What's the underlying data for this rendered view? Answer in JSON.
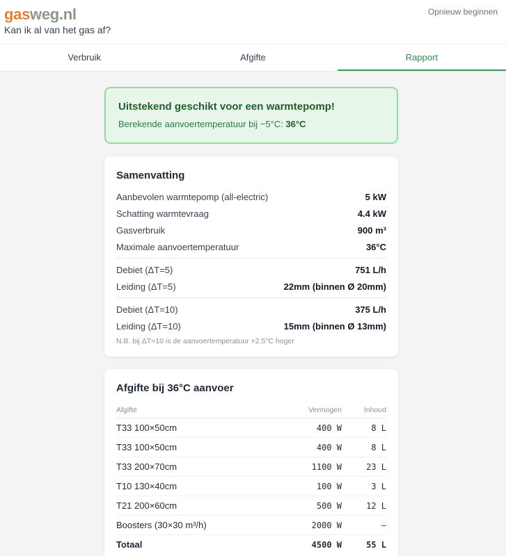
{
  "header": {
    "logo_part1": "gas",
    "logo_part2": "weg",
    "logo_part3": ".nl",
    "tagline": "Kan ik al van het gas af?",
    "restart_label": "Opnieuw beginnen"
  },
  "tabs": [
    {
      "label": "Verbruik",
      "active": false
    },
    {
      "label": "Afgifte",
      "active": false
    },
    {
      "label": "Rapport",
      "active": true
    }
  ],
  "banner": {
    "title": "Uitstekend geschikt voor een warmtepomp!",
    "sub_text": "Berekende aanvoertemperatuur bij −5°C:",
    "sub_value": "36°C"
  },
  "summary": {
    "title": "Samenvatting",
    "rows": [
      {
        "label": "Aanbevolen warmtepomp (all-electric)",
        "value": "5 kW"
      },
      {
        "label": "Schatting warmtevraag",
        "value": "4.4 kW"
      },
      {
        "label": "Gasverbruik",
        "value": "900 m³"
      },
      {
        "label": "Maximale aanvoertemperatuur",
        "value": "36°C"
      }
    ],
    "dt5": [
      {
        "label": "Debiet (ΔT=5)",
        "value": "751 L/h"
      },
      {
        "label": "Leiding (ΔT=5)",
        "value": "22mm (binnen Ø 20mm)"
      }
    ],
    "dt10": [
      {
        "label": "Debiet (ΔT=10)",
        "value": "375 L/h"
      },
      {
        "label": "Leiding (ΔT=10)",
        "value": "15mm (binnen Ø 13mm)"
      }
    ],
    "note": "N.B. bij ΔT=10 is de aanvoertemperatuur +2.5°C hoger"
  },
  "output": {
    "title": "Afgifte bij 36°C aanvoer",
    "headers": {
      "col1": "Afgifte",
      "col2": "Vermogen",
      "col3": "Inhoud"
    },
    "rows": [
      {
        "name": "T33 100×50cm",
        "power": "400 W",
        "volume": "8 L"
      },
      {
        "name": "T33 100×50cm",
        "power": "400 W",
        "volume": "8 L"
      },
      {
        "name": "T33 200×70cm",
        "power": "1100 W",
        "volume": "23 L"
      },
      {
        "name": "T10 130×40cm",
        "power": "100 W",
        "volume": "3 L"
      },
      {
        "name": "T21 200×60cm",
        "power": "500 W",
        "volume": "12 L"
      },
      {
        "name": "Boosters (30×30 m³/h)",
        "power": "2000 W",
        "volume": "—"
      }
    ],
    "total": {
      "name": "Totaal",
      "power": "4500 W",
      "volume": "55 L"
    }
  },
  "colors": {
    "accent_green": "#2f8a4f",
    "logo_orange": "#e8812b",
    "logo_grey": "#8a9a84",
    "banner_bg": "#e8f6ea",
    "banner_border": "#8fdb9f"
  }
}
